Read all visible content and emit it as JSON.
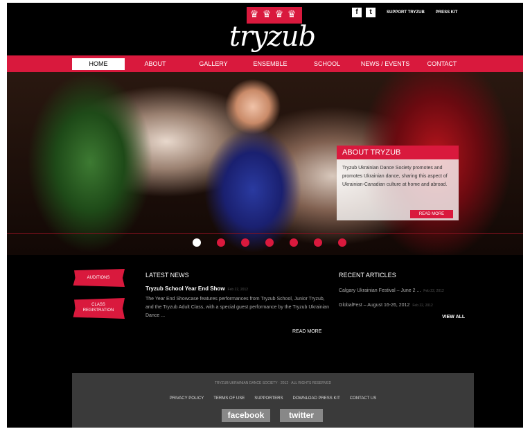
{
  "header": {
    "logo_text": "tryzub",
    "facebook_icon": "f",
    "twitter_icon": "t",
    "support_link": "SUPPORT TRYZUB",
    "press_link": "PRESS KIT"
  },
  "nav": {
    "items": [
      "HOME",
      "ABOUT",
      "GALLERY",
      "ENSEMBLE",
      "SCHOOL",
      "NEWS / EVENTS",
      "CONTACT"
    ],
    "active": "HOME"
  },
  "hero": {
    "panel_title": "ABOUT TRYZUB",
    "panel_text": "Tryzub Ukrainian Dance Society promotes and promotes Ukrainian dance, sharing this aspect of Ukrainian-Canadian culture at home and abroad.",
    "panel_button": "READ MORE",
    "slide_count": 7,
    "active_slide": 1
  },
  "sidebar": {
    "audition_button": "AUDITIONS",
    "class_button_line1": "CLASS",
    "class_button_line2": "REGISTRATION"
  },
  "latest_news": {
    "title": "LATEST NEWS",
    "headline": "Tryzub School Year End Show",
    "date": "Feb 22, 2012",
    "body": "The Year End Showcase features performances from Tryzub School, Junior Tryzub, and the Tryzub Adult Class, with a special guest performance by the Tryzub Ukrainian Dance ...",
    "read_more": "READ MORE"
  },
  "recent_articles": {
    "title": "RECENT ARTICLES",
    "items": [
      {
        "text": "Calgary Ukrainian Festival – June 2 ...",
        "date": "Feb 22, 2012"
      },
      {
        "text": "GlobalFest – August 16-26, 2012",
        "date": "Feb 22, 2012"
      }
    ],
    "view_all": "VIEW ALL"
  },
  "footer": {
    "copyright": "TRYZUB UKRAINIAN DANCE SOCIETY · 2012 · ALL RIGHTS RESERVED",
    "links": [
      "PRIVACY POLICY",
      "TERMS OF USE",
      "SUPPORTERS",
      "DOWNLOAD PRESS KIT",
      "CONTACT US"
    ],
    "facebook": "facebook",
    "twitter": "twitter"
  },
  "colors": {
    "brand_red": "#d9193d",
    "background": "#000000",
    "footer_bg": "#3a3a3a"
  }
}
